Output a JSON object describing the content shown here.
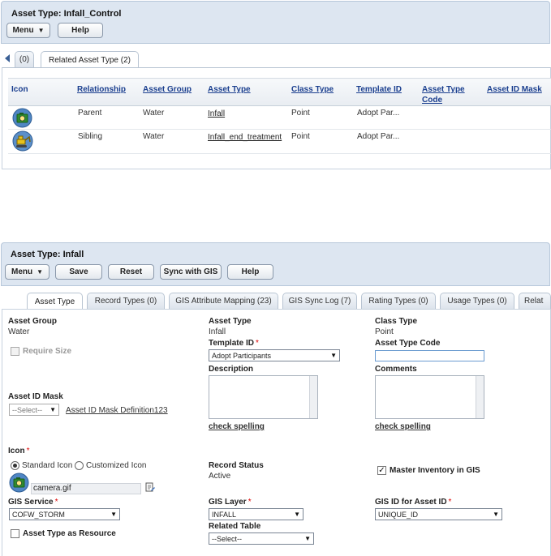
{
  "top": {
    "title": "Asset Type: Infall_Control",
    "menu_label": "Menu",
    "help_label": "Help",
    "tabs": [
      {
        "label": "(0)"
      },
      {
        "label": "Related Asset Type (2)"
      }
    ],
    "grid": {
      "columns": [
        "Icon",
        "Relationship",
        "Asset Group",
        "Asset Type",
        "Class Type",
        "Template ID",
        "Asset Type Code",
        "Asset ID Mask"
      ],
      "rows": [
        {
          "icon": "camera-icon",
          "relationship": "Parent",
          "asset_group": "Water",
          "asset_type": "Infall",
          "class_type": "Point",
          "template_id": "Adopt Par..."
        },
        {
          "icon": "excavator-icon",
          "relationship": "Sibling",
          "asset_group": "Water",
          "asset_type": "Infall_end_treatment",
          "class_type": "Point",
          "template_id": "Adopt Par..."
        }
      ]
    }
  },
  "bottom": {
    "title": "Asset Type: Infall",
    "buttons": {
      "menu": "Menu",
      "save": "Save",
      "reset": "Reset",
      "sync": "Sync with GIS",
      "help": "Help"
    },
    "tabs": [
      {
        "label": "Asset Type"
      },
      {
        "label": "Record Types (0)"
      },
      {
        "label": "GIS Attribute Mapping (23)"
      },
      {
        "label": "GIS Sync Log (7)"
      },
      {
        "label": "Rating Types (0)"
      },
      {
        "label": "Usage Types (0)"
      },
      {
        "label": "Relat"
      }
    ],
    "form": {
      "asset_group_label": "Asset Group",
      "asset_group_value": "Water",
      "asset_type_label": "Asset Type",
      "asset_type_value": "Infall",
      "class_type_label": "Class Type",
      "class_type_value": "Point",
      "require_size_label": "Require Size",
      "template_id_label": "Template ID",
      "template_id_value": "Adopt Participants",
      "asset_type_code_label": "Asset Type Code",
      "asset_type_code_value": "",
      "description_label": "Description",
      "comments_label": "Comments",
      "check_spelling_1": "check spelling",
      "check_spelling_2": "check spelling",
      "asset_id_mask_label": "Asset ID Mask",
      "asset_id_mask_value": "--Select--",
      "asset_id_mask_link": "Asset ID Mask Definition123",
      "icon_label": "Icon",
      "standard_icon_label": "Standard Icon",
      "customized_icon_label": "Customized Icon",
      "icon_file": "camera.gif",
      "record_status_label": "Record Status",
      "record_status_value": "Active",
      "master_inventory_label": "Master Inventory in GIS",
      "master_inventory_checked": true,
      "gis_service_label": "GIS Service",
      "gis_service_value": "COFW_STORM",
      "gis_layer_label": "GIS Layer",
      "gis_layer_value": "INFALL",
      "gis_id_label": "GIS ID for Asset ID",
      "gis_id_value": "UNIQUE_ID",
      "asset_type_resource_label": "Asset Type as Resource",
      "related_table_label": "Related Table",
      "related_table_value": "--Select--",
      "required_mark": "*",
      "check_mark": "✓"
    }
  }
}
